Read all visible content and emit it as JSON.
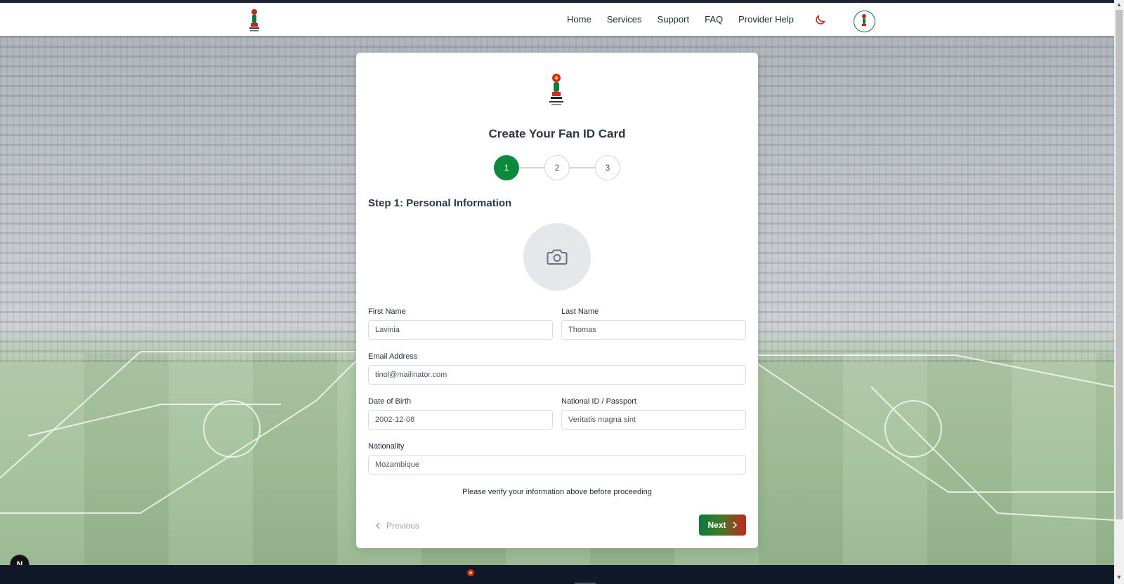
{
  "nav": {
    "links": [
      "Home",
      "Services",
      "Support",
      "FAQ",
      "Provider Help"
    ],
    "theme_toggle_icon": "moon-icon",
    "profile_icon": "trophy-logo-icon"
  },
  "card": {
    "title": "Create Your Fan ID Card",
    "steps": [
      "1",
      "2",
      "3"
    ],
    "active_step": "1",
    "section_title": "Step 1: Personal Information",
    "photo_icon": "camera-icon",
    "fields": {
      "first_name": {
        "label": "First Name",
        "value": "Lavinia"
      },
      "last_name": {
        "label": "Last Name",
        "value": "Thomas"
      },
      "email": {
        "label": "Email Address",
        "value": "tinol@mailinator.com"
      },
      "dob": {
        "label": "Date of Birth",
        "value": "2002-12-08"
      },
      "national_id": {
        "label": "National ID / Passport",
        "value": "Veritatis magna sint"
      },
      "nationality": {
        "label": "Nationality",
        "value": "Mozambique"
      }
    },
    "verify_note": "Please verify your information above before proceeding",
    "previous_label": "Previous",
    "next_label": "Next"
  },
  "dev_badge": "N",
  "colors": {
    "brand_green": "#0b8a3e",
    "brand_red": "#c0281c",
    "footer_bg": "#111827"
  }
}
